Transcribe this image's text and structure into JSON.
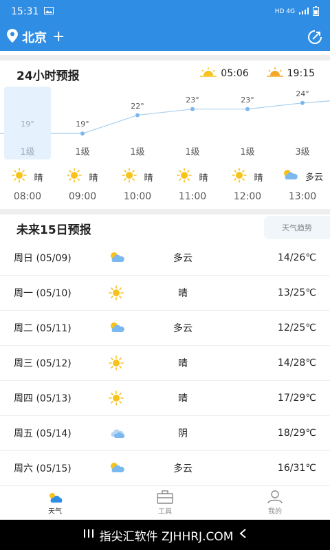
{
  "status_bar": {
    "time": "15:31",
    "indicators": "HD 4G"
  },
  "app_bar": {
    "city": "北京",
    "plus": "+"
  },
  "forecast24": {
    "title": "24小时预报",
    "sunrise": "05:06",
    "sunset": "19:15",
    "hours": [
      {
        "temp": "19°",
        "temp_value": 19,
        "wind": "1级",
        "cond": "晴",
        "icon": "sun-icon",
        "time": "08:00",
        "selected": true
      },
      {
        "temp": "19°",
        "temp_value": 19,
        "wind": "1级",
        "cond": "晴",
        "icon": "sun-icon",
        "time": "09:00"
      },
      {
        "temp": "22°",
        "temp_value": 22,
        "wind": "1级",
        "cond": "晴",
        "icon": "sun-icon",
        "time": "10:00"
      },
      {
        "temp": "23°",
        "temp_value": 23,
        "wind": "1级",
        "cond": "晴",
        "icon": "sun-icon",
        "time": "11:00"
      },
      {
        "temp": "23°",
        "temp_value": 23,
        "wind": "1级",
        "cond": "晴",
        "icon": "sun-icon",
        "time": "12:00"
      },
      {
        "temp": "24°",
        "temp_value": 24,
        "wind": "3级",
        "cond": "多云",
        "icon": "cloudy-icon",
        "time": "13:00"
      }
    ]
  },
  "forecast15": {
    "title": "未来15日预报",
    "trend_label": "天气趋势",
    "days": [
      {
        "date": "周日 (05/09)",
        "icon": "cloudy-icon",
        "cond": "多云",
        "range": "14/26℃"
      },
      {
        "date": "周一 (05/10)",
        "icon": "sun-icon",
        "cond": "晴",
        "range": "13/25℃"
      },
      {
        "date": "周二 (05/11)",
        "icon": "cloudy-icon",
        "cond": "多云",
        "range": "12/25℃"
      },
      {
        "date": "周三 (05/12)",
        "icon": "sun-icon",
        "cond": "晴",
        "range": "14/28℃"
      },
      {
        "date": "周四 (05/13)",
        "icon": "sun-icon",
        "cond": "晴",
        "range": "17/29℃"
      },
      {
        "date": "周五 (05/14)",
        "icon": "overcast-icon",
        "cond": "阴",
        "range": "18/29℃"
      },
      {
        "date": "周六 (05/15)",
        "icon": "cloudy-icon",
        "cond": "多云",
        "range": "16/31℃"
      }
    ]
  },
  "bottom_nav": [
    {
      "label": "天气",
      "icon": "weather-tab-icon",
      "active": true
    },
    {
      "label": "工具",
      "icon": "toolbox-icon"
    },
    {
      "label": "我的",
      "icon": "profile-icon"
    }
  ],
  "system_bar": {
    "watermark": "指尖汇软件 ZJHHRJ.COM"
  },
  "colors": {
    "brand": "#2f8de4",
    "sun": "#f7c21b",
    "cloud": "#7ab8ef"
  }
}
